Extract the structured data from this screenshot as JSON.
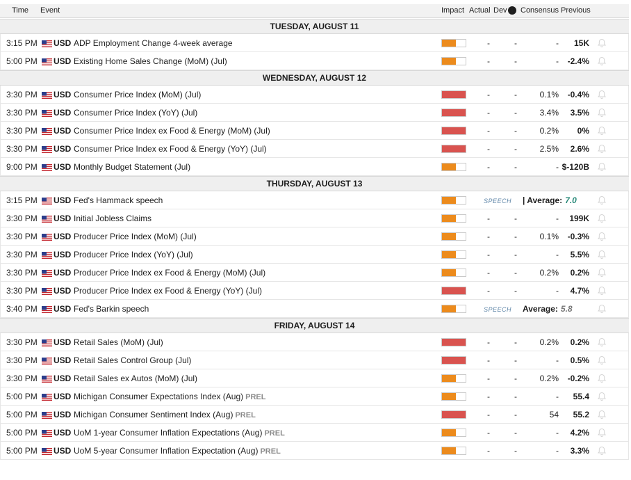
{
  "header": {
    "time": "Time",
    "event": "Event",
    "impact": "Impact",
    "actual": "Actual",
    "dev": "Dev",
    "consensus": "Consensus",
    "previous": "Previous"
  },
  "colors": {
    "high": "#d9534f",
    "medium": "#ec8b1d"
  },
  "days": [
    {
      "label": "TUESDAY, AUGUST 11",
      "events": [
        {
          "time": "3:15 PM",
          "currency": "USD",
          "event": "ADP Employment Change 4-week average",
          "prel": "",
          "impact": "medium",
          "actual": "-",
          "dev": "-",
          "consensus": "-",
          "previous": "15K"
        },
        {
          "time": "5:00 PM",
          "currency": "USD",
          "event": "Existing Home Sales Change (MoM) (Jul)",
          "prel": "",
          "impact": "medium",
          "actual": "-",
          "dev": "-",
          "consensus": "-",
          "previous": "-2.4%"
        }
      ]
    },
    {
      "label": "WEDNESDAY, AUGUST 12",
      "events": [
        {
          "time": "3:30 PM",
          "currency": "USD",
          "event": "Consumer Price Index (MoM) (Jul)",
          "prel": "",
          "impact": "high",
          "actual": "-",
          "dev": "-",
          "consensus": "0.1%",
          "previous": "-0.4%"
        },
        {
          "time": "3:30 PM",
          "currency": "USD",
          "event": "Consumer Price Index (YoY) (Jul)",
          "prel": "",
          "impact": "high",
          "actual": "-",
          "dev": "-",
          "consensus": "3.4%",
          "previous": "3.5%"
        },
        {
          "time": "3:30 PM",
          "currency": "USD",
          "event": "Consumer Price Index ex Food & Energy (MoM) (Jul)",
          "prel": "",
          "impact": "high",
          "actual": "-",
          "dev": "-",
          "consensus": "0.2%",
          "previous": "0%"
        },
        {
          "time": "3:30 PM",
          "currency": "USD",
          "event": "Consumer Price Index ex Food & Energy (YoY) (Jul)",
          "prel": "",
          "impact": "high",
          "actual": "-",
          "dev": "-",
          "consensus": "2.5%",
          "previous": "2.6%"
        },
        {
          "time": "9:00 PM",
          "currency": "USD",
          "event": "Monthly Budget Statement (Jul)",
          "prel": "",
          "impact": "medium",
          "actual": "-",
          "dev": "-",
          "consensus": "-",
          "previous": "$-120B"
        }
      ]
    },
    {
      "label": "THURSDAY, AUGUST 13",
      "events": [
        {
          "time": "3:15 PM",
          "currency": "USD",
          "event": "Fed's Hammack speech",
          "prel": "",
          "impact": "medium",
          "speech": "SPEECH",
          "avg_label": "| Average:",
          "avg_value": "7.0",
          "avg_color": "#2a8a7a"
        },
        {
          "time": "3:30 PM",
          "currency": "USD",
          "event": "Initial Jobless Claims",
          "prel": "",
          "impact": "medium",
          "actual": "-",
          "dev": "-",
          "consensus": "-",
          "previous": "199K"
        },
        {
          "time": "3:30 PM",
          "currency": "USD",
          "event": "Producer Price Index (MoM) (Jul)",
          "prel": "",
          "impact": "medium",
          "actual": "-",
          "dev": "-",
          "consensus": "0.1%",
          "previous": "-0.3%"
        },
        {
          "time": "3:30 PM",
          "currency": "USD",
          "event": "Producer Price Index (YoY) (Jul)",
          "prel": "",
          "impact": "medium",
          "actual": "-",
          "dev": "-",
          "consensus": "-",
          "previous": "5.5%"
        },
        {
          "time": "3:30 PM",
          "currency": "USD",
          "event": "Producer Price Index ex Food & Energy (MoM) (Jul)",
          "prel": "",
          "impact": "medium",
          "actual": "-",
          "dev": "-",
          "consensus": "0.2%",
          "previous": "0.2%"
        },
        {
          "time": "3:30 PM",
          "currency": "USD",
          "event": "Producer Price Index ex Food & Energy (YoY) (Jul)",
          "prel": "",
          "impact": "high",
          "actual": "-",
          "dev": "-",
          "consensus": "-",
          "previous": "4.7%"
        },
        {
          "time": "3:40 PM",
          "currency": "USD",
          "event": "Fed's Barkin speech",
          "prel": "",
          "impact": "medium",
          "speech": "SPEECH",
          "avg_label": "Average:",
          "avg_value": "5.8",
          "avg_color": "#777777"
        }
      ]
    },
    {
      "label": "FRIDAY, AUGUST 14",
      "events": [
        {
          "time": "3:30 PM",
          "currency": "USD",
          "event": "Retail Sales (MoM) (Jul)",
          "prel": "",
          "impact": "high",
          "actual": "-",
          "dev": "-",
          "consensus": "0.2%",
          "previous": "0.2%"
        },
        {
          "time": "3:30 PM",
          "currency": "USD",
          "event": "Retail Sales Control Group (Jul)",
          "prel": "",
          "impact": "high",
          "actual": "-",
          "dev": "-",
          "consensus": "-",
          "previous": "0.5%"
        },
        {
          "time": "3:30 PM",
          "currency": "USD",
          "event": "Retail Sales ex Autos (MoM) (Jul)",
          "prel": "",
          "impact": "medium",
          "actual": "-",
          "dev": "-",
          "consensus": "0.2%",
          "previous": "-0.2%"
        },
        {
          "time": "5:00 PM",
          "currency": "USD",
          "event": "Michigan Consumer Expectations Index (Aug)",
          "prel": "PREL",
          "impact": "medium",
          "actual": "-",
          "dev": "-",
          "consensus": "-",
          "previous": "55.4"
        },
        {
          "time": "5:00 PM",
          "currency": "USD",
          "event": "Michigan Consumer Sentiment Index (Aug)",
          "prel": "PREL",
          "impact": "high",
          "actual": "-",
          "dev": "-",
          "consensus": "54",
          "previous": "55.2"
        },
        {
          "time": "5:00 PM",
          "currency": "USD",
          "event": "UoM 1-year Consumer Inflation Expectations (Aug)",
          "prel": "PREL",
          "impact": "medium",
          "actual": "-",
          "dev": "-",
          "consensus": "-",
          "previous": "4.2%"
        },
        {
          "time": "5:00 PM",
          "currency": "USD",
          "event": "UoM 5-year Consumer Inflation Expectation (Aug)",
          "prel": "PREL",
          "impact": "medium",
          "actual": "-",
          "dev": "-",
          "consensus": "-",
          "previous": "3.3%"
        }
      ]
    }
  ]
}
